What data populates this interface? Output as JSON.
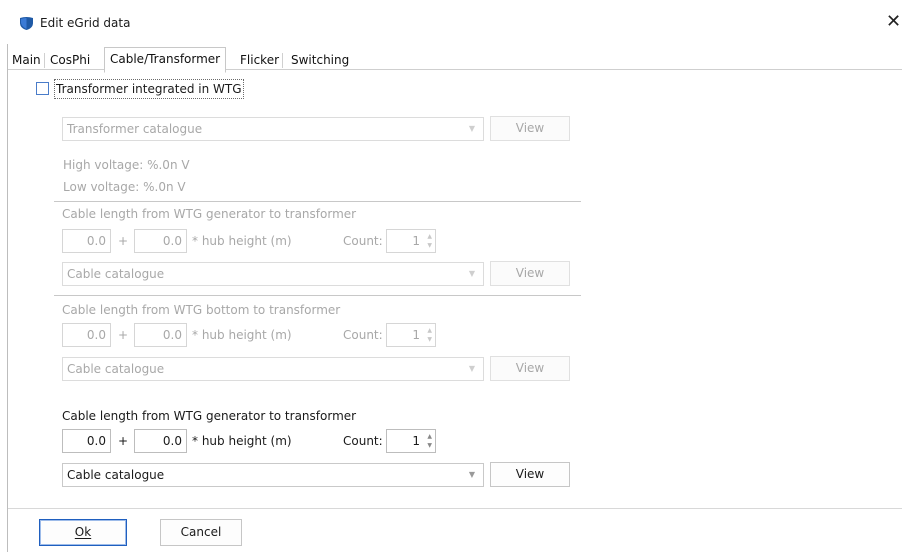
{
  "window": {
    "title": "Edit eGrid data",
    "close": "✕"
  },
  "tabs": [
    "Main",
    "CosPhi",
    "Cable/Transformer",
    "Flicker",
    "Switching"
  ],
  "transformer": {
    "checkbox_label": "Transformer integrated in WTG",
    "checked": false,
    "catalogue": "Transformer catalogue",
    "view": "View",
    "high_voltage": "High voltage: %.0n V",
    "low_voltage": "Low voltage: %.0n V"
  },
  "cable_sections": [
    {
      "title": "Cable length from WTG generator to transformer",
      "value1": "0.0",
      "plus": "+",
      "value2": "0.0",
      "hub_label": "* hub height (m)",
      "count_label": "Count:",
      "count": "1",
      "catalogue": "Cable catalogue",
      "view": "View",
      "enabled": false
    },
    {
      "title": "Cable length from WTG bottom to transformer",
      "value1": "0.0",
      "plus": "+",
      "value2": "0.0",
      "hub_label": "* hub height (m)",
      "count_label": "Count:",
      "count": "1",
      "catalogue": "Cable catalogue",
      "view": "View",
      "enabled": false
    },
    {
      "title": "Cable length from WTG generator to transformer",
      "value1": "0.0",
      "plus": "+",
      "value2": "0.0",
      "hub_label": "* hub height (m)",
      "count_label": "Count:",
      "count": "1",
      "catalogue": "Cable catalogue",
      "view": "View",
      "enabled": true
    }
  ],
  "footer": {
    "ok": "Ok",
    "cancel": "Cancel"
  },
  "icons": {
    "app": "shield-icon",
    "dropdown": "chevron-down-icon",
    "spin": "spin-arrows-icon",
    "close": "close-icon"
  },
  "colors": {
    "accent": "#1f5fbf",
    "checkbox_border": "#4a7cc9",
    "disabled_text": "#a8a8a8",
    "app_icon": "#1f5aa6"
  }
}
